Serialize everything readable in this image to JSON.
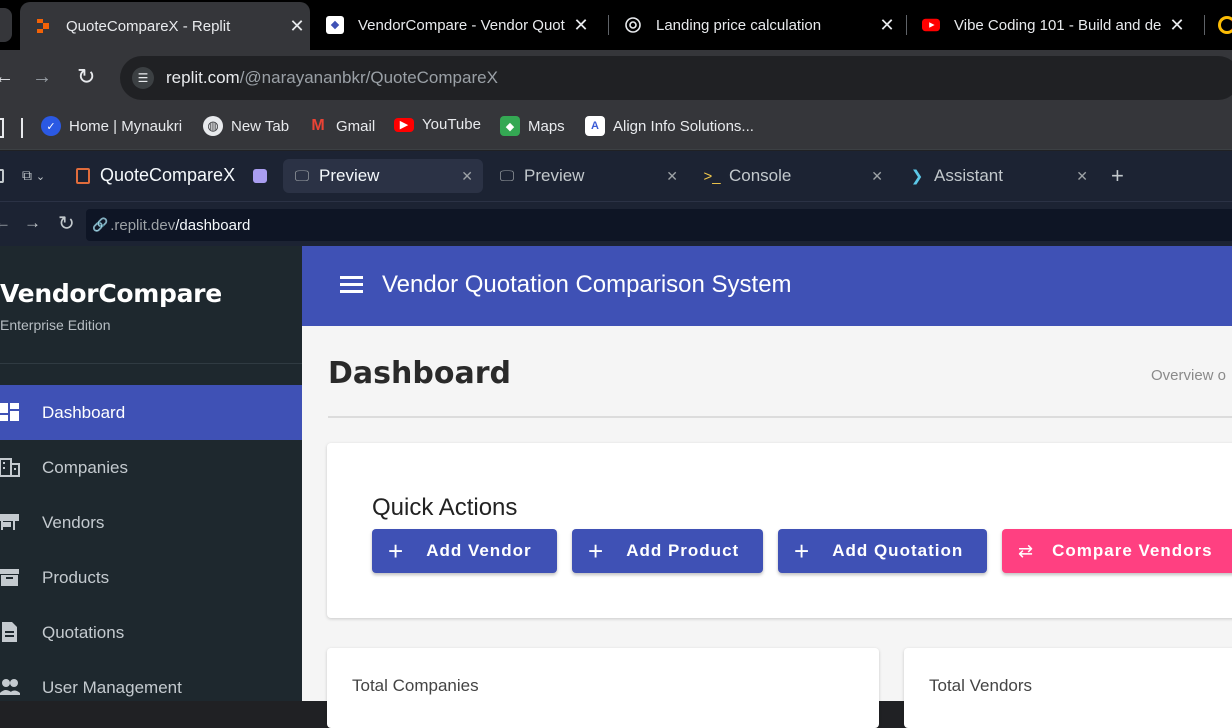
{
  "browser": {
    "tabs": [
      {
        "title": "QuoteCompareX - Replit",
        "active": true,
        "icon": "replit-icon"
      },
      {
        "title": "VendorCompare - Vendor Quot",
        "active": false,
        "icon": "app-icon"
      },
      {
        "title": "Landing price calculation",
        "active": false,
        "icon": "chatgpt-icon"
      },
      {
        "title": "Vibe Coding 101 - Build and de",
        "active": false,
        "icon": "youtube-icon"
      }
    ],
    "address": {
      "host": "replit.com",
      "path": "/@narayananbkr/QuoteCompareX"
    },
    "bookmarks": [
      {
        "label": "Home | Mynaukri",
        "icon": "mynaukri-icon",
        "color": "#2b59e3"
      },
      {
        "label": "New Tab",
        "icon": "globe-icon",
        "color": "#e8eaed"
      },
      {
        "label": "Gmail",
        "icon": "gmail-icon",
        "color": "#ea4335"
      },
      {
        "label": "YouTube",
        "icon": "youtube-icon",
        "color": "#ff0000"
      },
      {
        "label": "Maps",
        "icon": "maps-icon",
        "color": "#34a853"
      },
      {
        "label": "Align Info Solutions...",
        "icon": "align-icon",
        "color": "#3b5bd6"
      }
    ]
  },
  "replit": {
    "project": "QuoteCompareX",
    "tabs": [
      {
        "label": "Preview",
        "active": true,
        "icon": "monitor-icon"
      },
      {
        "label": "Preview",
        "active": false,
        "icon": "monitor-icon"
      },
      {
        "label": "Console",
        "active": false,
        "icon": "terminal-icon"
      },
      {
        "label": "Assistant",
        "active": false,
        "icon": "assistant-icon"
      }
    ],
    "preview_url": {
      "host": ".replit.dev",
      "path": "/dashboard"
    }
  },
  "app": {
    "brand": "VendorCompare",
    "edition": "Enterprise Edition",
    "title": "Vendor Quotation Comparison System",
    "accent": "#3f51b5",
    "secondary": "#ff4081",
    "nav": [
      {
        "label": "Dashboard",
        "active": true,
        "icon": "dashboard-icon"
      },
      {
        "label": "Companies",
        "active": false,
        "icon": "building-icon"
      },
      {
        "label": "Vendors",
        "active": false,
        "icon": "store-icon"
      },
      {
        "label": "Products",
        "active": false,
        "icon": "archive-icon"
      },
      {
        "label": "Quotations",
        "active": false,
        "icon": "document-icon"
      },
      {
        "label": "User Management",
        "active": false,
        "icon": "people-icon"
      }
    ],
    "page": {
      "title": "Dashboard",
      "subtitle": "Overview o"
    },
    "quick_actions": {
      "title": "Quick Actions",
      "buttons": [
        "Add Vendor",
        "Add Product",
        "Add Quotation",
        "Compare Vendors"
      ]
    },
    "stats": [
      "Total Companies",
      "Total Vendors"
    ]
  }
}
